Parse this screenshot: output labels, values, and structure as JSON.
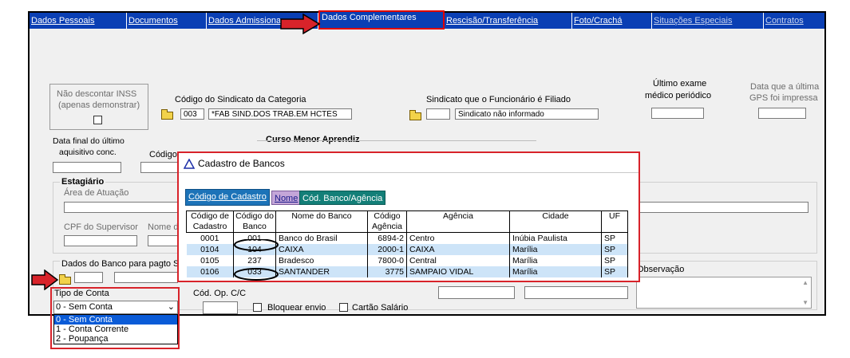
{
  "tabs": [
    {
      "label": "Dados Pessoais"
    },
    {
      "label": "Documentos"
    },
    {
      "label": "Dados Admissiona"
    },
    {
      "label": "Dados Complementares"
    },
    {
      "label": "Rescisão/Transferência"
    },
    {
      "label": "Foto/Crachá"
    },
    {
      "label": "Situações Especiais"
    },
    {
      "label": "Contratos"
    }
  ],
  "inss": {
    "line1": "Não descontar INSS",
    "line2": "(apenas demonstrar)"
  },
  "sindicato": {
    "label": "Código do Sindicato da Categoria",
    "code": "003",
    "name": "*FAB SIND.DOS TRAB.EM HCTÉS",
    "filiado_label": "Sindicato que o Funcionário é Filiado",
    "filiado_value": "Sindicato não informado"
  },
  "exame": {
    "line1": "Último exame",
    "line2": "médico periódico"
  },
  "gps": {
    "line1": "Data que a última",
    "line2": "GPS foi impressa"
  },
  "aquisitivo": {
    "line1": "Data final do último",
    "line2": "aquisitivo conc."
  },
  "codigo_label": "Código",
  "curso_label": "Curso Menor Aprendiz",
  "estagiario": {
    "title": "Estagiário",
    "area_label": "Área de Atuação",
    "cpf_label": "CPF do Supervisor",
    "nome_label": "Nome d"
  },
  "banco_label": "Dados do Banco para pagto S",
  "tipo_conta": {
    "label": "Tipo de Conta",
    "selected": "0 - Sem Conta",
    "options": [
      "0 - Sem Conta",
      "1 - Conta Corrente",
      "2 - Poupança"
    ]
  },
  "cod_op_label": "Cód. Op. C/C",
  "bloquear_label": "Bloquear envio",
  "cartao_label": "Cartão Salário",
  "observacao_label": "Observação",
  "modal": {
    "title": "Cadastro de Bancos",
    "tabs": [
      "Código de Cadastro",
      "Nome",
      "Cód. Banco/Agência"
    ],
    "headers": [
      [
        "Código de",
        "Cadastro"
      ],
      [
        "Código do",
        "Banco"
      ],
      [
        "Nome do Banco",
        ""
      ],
      [
        "Código",
        "Agência"
      ],
      [
        "Agência",
        ""
      ],
      [
        "Cidade",
        ""
      ],
      [
        "UF",
        ""
      ]
    ],
    "rows": [
      [
        "0001",
        "001",
        "Banco do Brasil",
        "6894-2",
        "Centro",
        "Inúbia Paulista",
        "SP"
      ],
      [
        "0104",
        "104",
        "CAIXA",
        "2000-1",
        "CAIXA",
        "Marília",
        "SP"
      ],
      [
        "0105",
        "237",
        "Bradesco",
        "7800-0",
        "Central",
        "Marília",
        "SP"
      ],
      [
        "0106",
        "033",
        "SANTANDER",
        "3775",
        "SAMPAIO VIDAL",
        "Marília",
        "SP"
      ]
    ]
  },
  "colors": {
    "tabbar": "#0a3fb4",
    "highlight": "#d8232a",
    "row_alt": "#cde4f8",
    "selected": "#0a5bd7"
  }
}
